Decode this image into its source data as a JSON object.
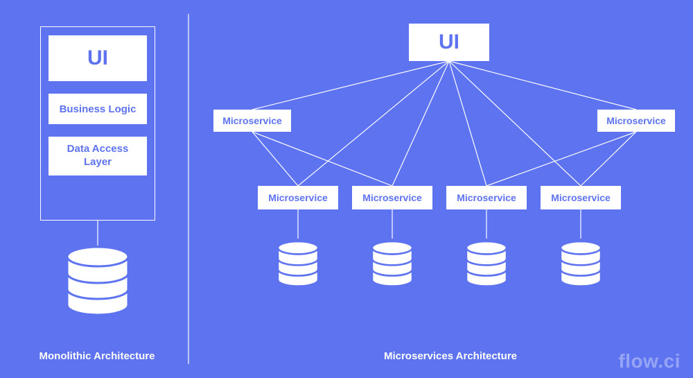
{
  "monolith": {
    "title": "Monolithic Architecture",
    "layers": {
      "ui": "UI",
      "bl": "Business Logic",
      "dal": "Data Access Layer"
    }
  },
  "micro": {
    "title": "Microservices Architecture",
    "ui": "UI",
    "top": {
      "svc_left": "Microservice",
      "svc_right": "Microservice"
    },
    "bottom": {
      "svc_1": "Microservice",
      "svc_2": "Microservice",
      "svc_3": "Microservice",
      "svc_4": "Microservice"
    }
  },
  "watermark": "flow.ci"
}
